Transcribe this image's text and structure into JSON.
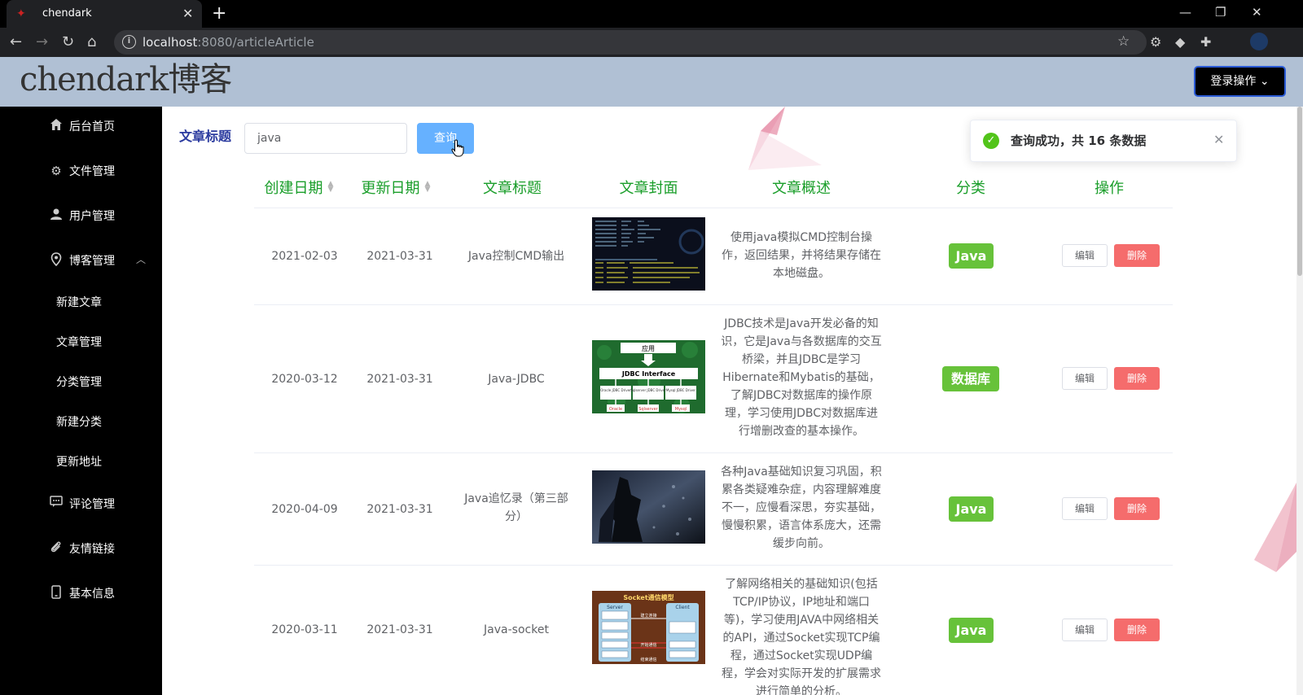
{
  "browser": {
    "tab_title": "chendark",
    "url_host": "localhost",
    "url_rest": ":8080/articleArticle"
  },
  "header": {
    "logo": "chendark博客",
    "login_label": "登录操作"
  },
  "sidebar": {
    "items": [
      {
        "label": "后台首页",
        "icon": "home-icon"
      },
      {
        "label": "文件管理",
        "icon": "gear-icon"
      },
      {
        "label": "用户管理",
        "icon": "user-icon"
      },
      {
        "label": "博客管理",
        "icon": "location-icon"
      },
      {
        "label": "评论管理",
        "icon": "comment-icon"
      },
      {
        "label": "友情链接",
        "icon": "paperclip-icon"
      },
      {
        "label": "基本信息",
        "icon": "phone-icon"
      }
    ],
    "blog_sub": [
      "新建文章",
      "文章管理",
      "分类管理",
      "新建分类",
      "更新地址"
    ]
  },
  "search": {
    "label": "文章标题",
    "value": "java",
    "button": "查询"
  },
  "toast": {
    "message": "查询成功，共 16 条数据"
  },
  "table": {
    "headers": [
      "创建日期",
      "更新日期",
      "文章标题",
      "文章封面",
      "文章概述",
      "分类",
      "操作"
    ],
    "rows": [
      {
        "created": "2021-02-03",
        "updated": "2021-03-31",
        "title": "Java控制CMD输出",
        "summary": "使用java模拟CMD控制台操作，返回结果，并将结果存储在本地磁盘。",
        "category": "Java",
        "edit": "编辑",
        "delete": "删除"
      },
      {
        "created": "2020-03-12",
        "updated": "2021-03-31",
        "title": "Java-JDBC",
        "summary": "JDBC技术是Java开发必备的知识，它是Java与各数据库的交互桥梁，并且JDBC是学习Hibernate和Mybatis的基础，了解JDBC对数据库的操作原理，学习使用JDBC对数据库进行增删改查的基本操作。",
        "category": "数据库",
        "edit": "编辑",
        "delete": "删除",
        "cover_text": {
          "top": "应用",
          "middle": "JDBC Interface",
          "d1": "Oracle JDBC Driver",
          "d2": "Sqlserver JDBC Driver",
          "d3": "Mysql JDBC Driver",
          "b1": "Oracle",
          "b2": "Sqlserver",
          "b3": "Mysql"
        }
      },
      {
        "created": "2020-04-09",
        "updated": "2021-03-31",
        "title": "Java追忆录（第三部分）",
        "summary": "各种Java基础知识复习巩固，积累各类疑难杂症，内容理解难度不一，应慢看深思，夯实基础，慢慢积累，语言体系庞大，还需缓步向前。",
        "category": "Java",
        "edit": "编辑",
        "delete": "删除"
      },
      {
        "created": "2020-03-11",
        "updated": "2021-03-31",
        "title": "Java-socket",
        "summary": "了解网络相关的基础知识(包括TCP/IP协议，IP地址和端口等)，学习使用JAVA中网络相关的API，通过Socket实现TCP编程，通过Socket实现UDP编程，学会对实际开发的扩展需求进行简单的分析。",
        "category": "Java",
        "edit": "编辑",
        "delete": "删除",
        "cover_text": {
          "title": "Socket通信模型",
          "server": "Server",
          "client": "Client",
          "connect": "建立连接",
          "comm": "开始通信",
          "end": "结束通信"
        }
      }
    ]
  },
  "colors": {
    "header_bg": "#b0c0d4",
    "sidebar_bg": "#000000",
    "table_header": "#1a9e2a",
    "tag_green": "#67c23a",
    "delete_red": "#f56c6c",
    "query_blue": "#66b1ff",
    "search_label": "#2a3a9f"
  }
}
